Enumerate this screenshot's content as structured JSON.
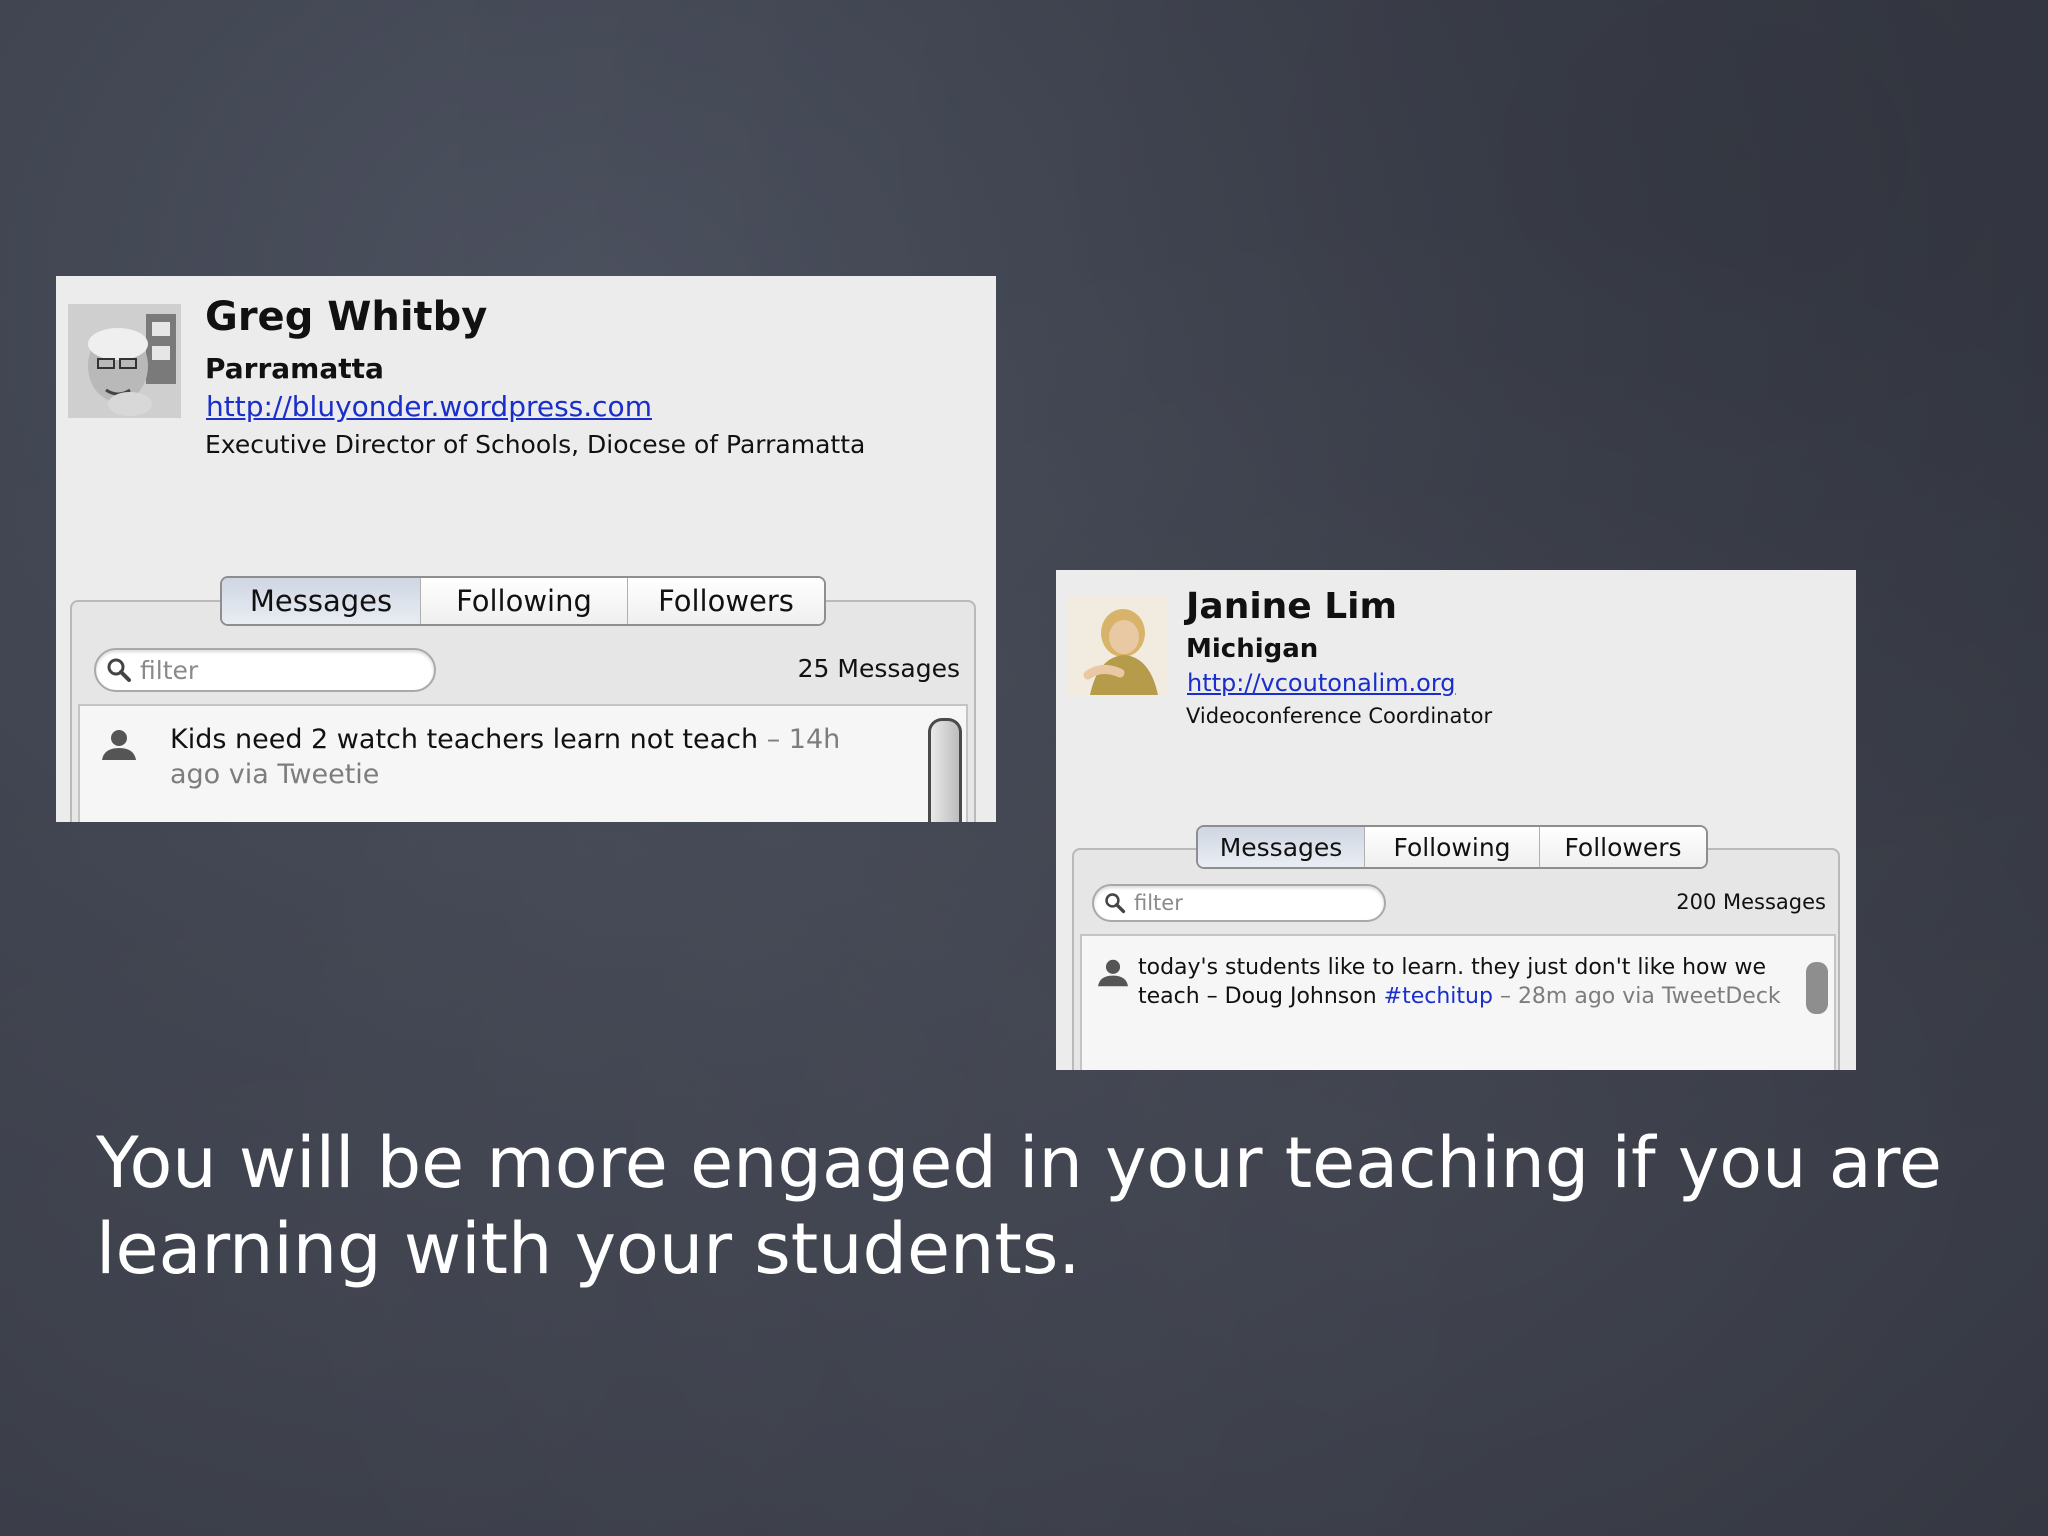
{
  "profiles": [
    {
      "name": "Greg Whitby",
      "location": "Parramatta",
      "url": "http://bluyonder.wordpress.com",
      "bio": "Executive Director of Schools, Diocese of Parramatta",
      "tabs": [
        "Messages",
        "Following",
        "Followers"
      ],
      "active_tab": "Messages",
      "filter_placeholder": "filter",
      "message_count": "25 Messages",
      "message": {
        "text": "Kids need 2 watch teachers learn not teach",
        "meta": " – 14h ago via Tweetie"
      }
    },
    {
      "name": "Janine Lim",
      "location": "Michigan",
      "url": "http://vcoutonalim.org",
      "bio": "Videoconference Coordinator",
      "tabs": [
        "Messages",
        "Following",
        "Followers"
      ],
      "active_tab": "Messages",
      "filter_placeholder": "filter",
      "message_count": "200 Messages",
      "message": {
        "text": "today's students like to learn. they just don't like how we teach – Doug Johnson ",
        "hashtag": "#techitup",
        "meta": " – 28m ago via TweetDeck"
      }
    }
  ],
  "caption": "You will be more engaged in your teaching if you are learning with your students.",
  "icons": {
    "avatar": "profile-photo",
    "search": "search-icon",
    "user": "user-icon"
  },
  "colors": {
    "link": "#1a2ecc",
    "background": "#3d414d",
    "caption_text": "#ffffff"
  }
}
